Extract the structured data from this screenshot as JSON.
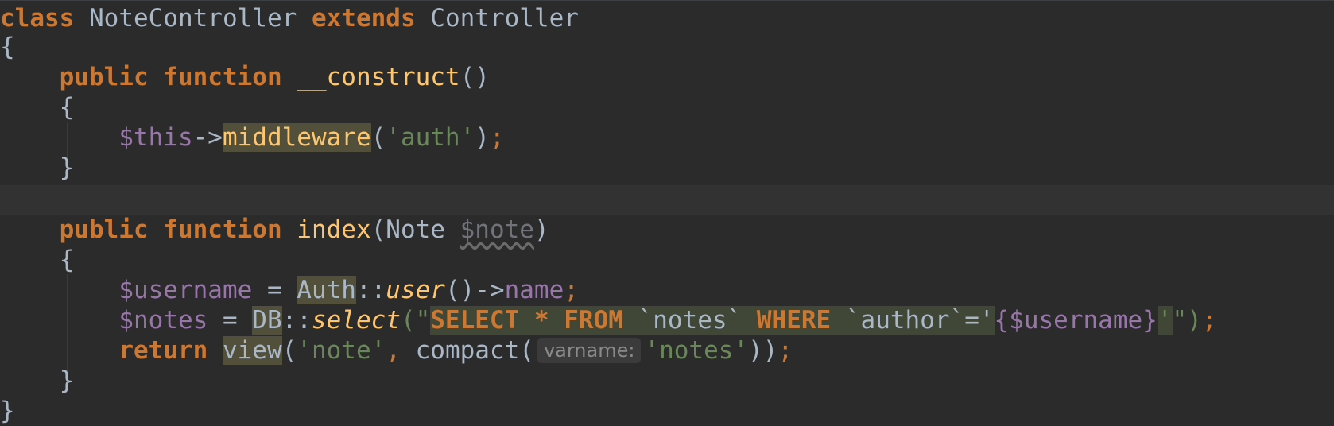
{
  "code": {
    "l1": {
      "kw_class": "class",
      "name": "NoteController",
      "kw_extends": "extends",
      "parent": "Controller"
    },
    "l2": {
      "brace": "{"
    },
    "l3": {
      "kw_public": "public",
      "kw_function": "function",
      "fn_name": "__construct",
      "parens": "()"
    },
    "l4": {
      "brace": "{"
    },
    "l5": {
      "var_this": "$this",
      "arrow": "->",
      "method": "middleware",
      "open": "(",
      "arg": "'auth'",
      "close": ")",
      "semi": ";"
    },
    "l6": {
      "brace": "}"
    },
    "l8": {
      "kw_public": "public",
      "kw_function": "function",
      "fn_name": "index",
      "open": "(",
      "type": "Note",
      "param": "$note",
      "close": ")"
    },
    "l9": {
      "brace": "{"
    },
    "l10": {
      "var": "$username",
      "assign": " = ",
      "cls": "Auth",
      "scope": "::",
      "method": "user",
      "call": "()->",
      "prop": "name",
      "semi": ";"
    },
    "l11": {
      "var": "$notes",
      "assign": " = ",
      "cls": "DB",
      "scope": "::",
      "method": "select",
      "open": "(\"",
      "sql_select": "SELECT",
      "sql_star": " * ",
      "sql_from": "FROM",
      "sql_table": " `notes` ",
      "sql_where": "WHERE",
      "sql_cond": " `author`='",
      "interp": "{$username}",
      "sql_end": "'",
      "close_quote": "\")",
      "semi": ";"
    },
    "l12": {
      "kw_return": "return",
      "fn": "view",
      "open": "(",
      "arg1": "'note'",
      "comma": ",",
      "fn2": "compact",
      "open2": "(",
      "hint": "varname:",
      "arg2": "'notes'",
      "close": "))",
      "semi": ";"
    },
    "l13": {
      "brace": "}"
    },
    "l14": {
      "brace": "}"
    }
  },
  "colors": {
    "background": "#2b2b2b",
    "keyword": "#cc7832",
    "function": "#ffc66d",
    "variable": "#9876aa",
    "string": "#6a8759",
    "text": "#a9b7c6"
  }
}
